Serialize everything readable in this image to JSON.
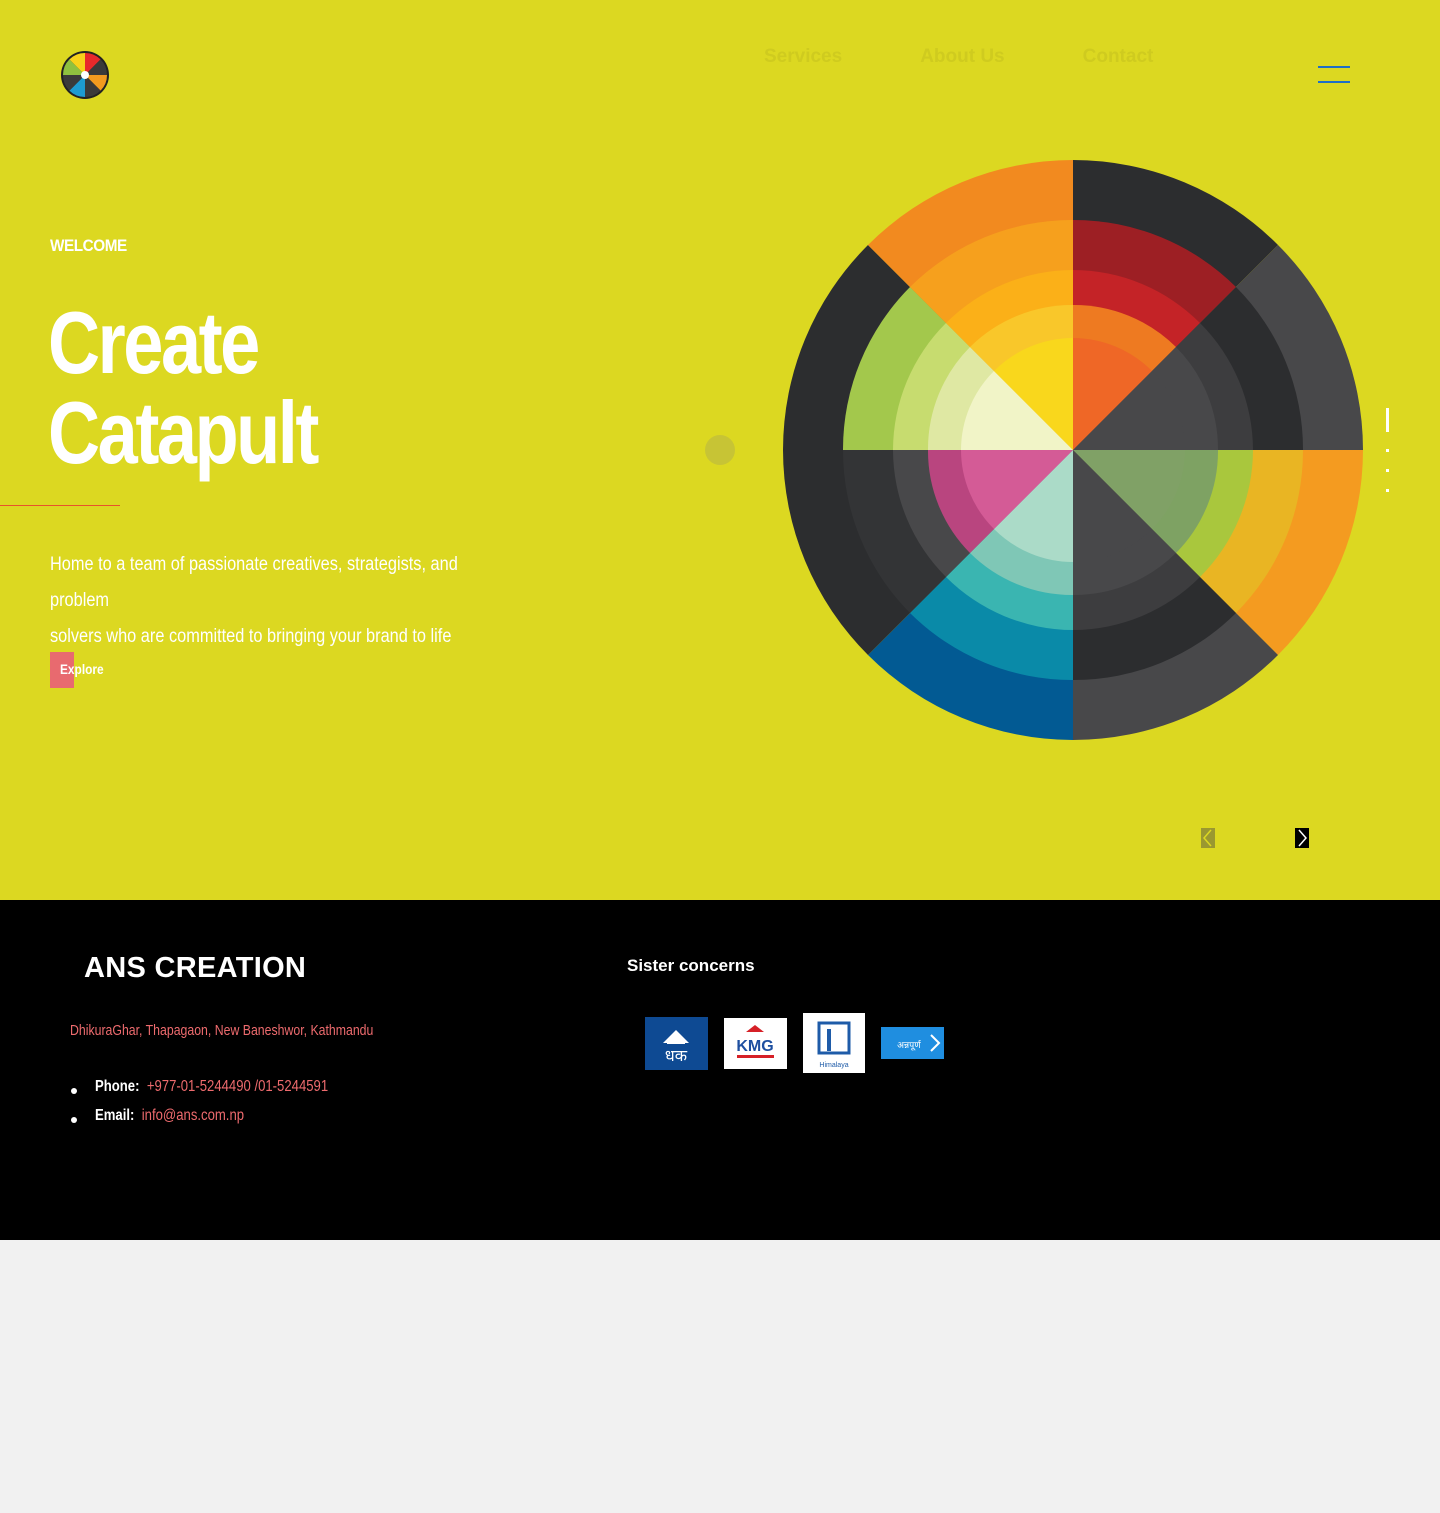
{
  "header": {
    "logo_icon": "color-wheel-logo",
    "nav": [
      "Services",
      "About Us",
      "Contact"
    ],
    "menu_icon": "hamburger-icon"
  },
  "hero": {
    "eyebrow": "WELCOME",
    "title_line1": "Create",
    "title_line2": "Catapult",
    "lead_line1": "Home to a team of passionate creatives, strategists, and problem",
    "lead_line2": "solvers who are committed to bringing your  brand  to  life",
    "cta_label": "Explore",
    "slide_count": 4,
    "active_slide": 1,
    "prev_icon": "chevron-left-icon",
    "next_icon": "chevron-right-icon"
  },
  "footer": {
    "brand": "ANS CREATION",
    "address": "DhikuraGhar, Thapagaon, New Baneshwor, Kathmandu",
    "phone_label": "Phone:",
    "phone_value": "+977-01-5244490 /01-5244591",
    "email_label": "Email:",
    "email_value": "info@ans.com.np",
    "sister_title": "Sister concerns",
    "sister_logos": [
      {
        "name": "dhikura-ghar-logo",
        "text": "धक"
      },
      {
        "name": "kmg-logo",
        "text": "KMG"
      },
      {
        "name": "himalaya-logo",
        "text": "Himalaya"
      },
      {
        "name": "annapurna-logo",
        "text": "अन्नपूर्ण"
      }
    ]
  },
  "colors": {
    "hero_bg": "#dcd821",
    "accent_pink": "#e86a6f",
    "accent_orange": "#e8532b",
    "footer_bg": "#000000",
    "page_bg": "#f1f1f1"
  }
}
